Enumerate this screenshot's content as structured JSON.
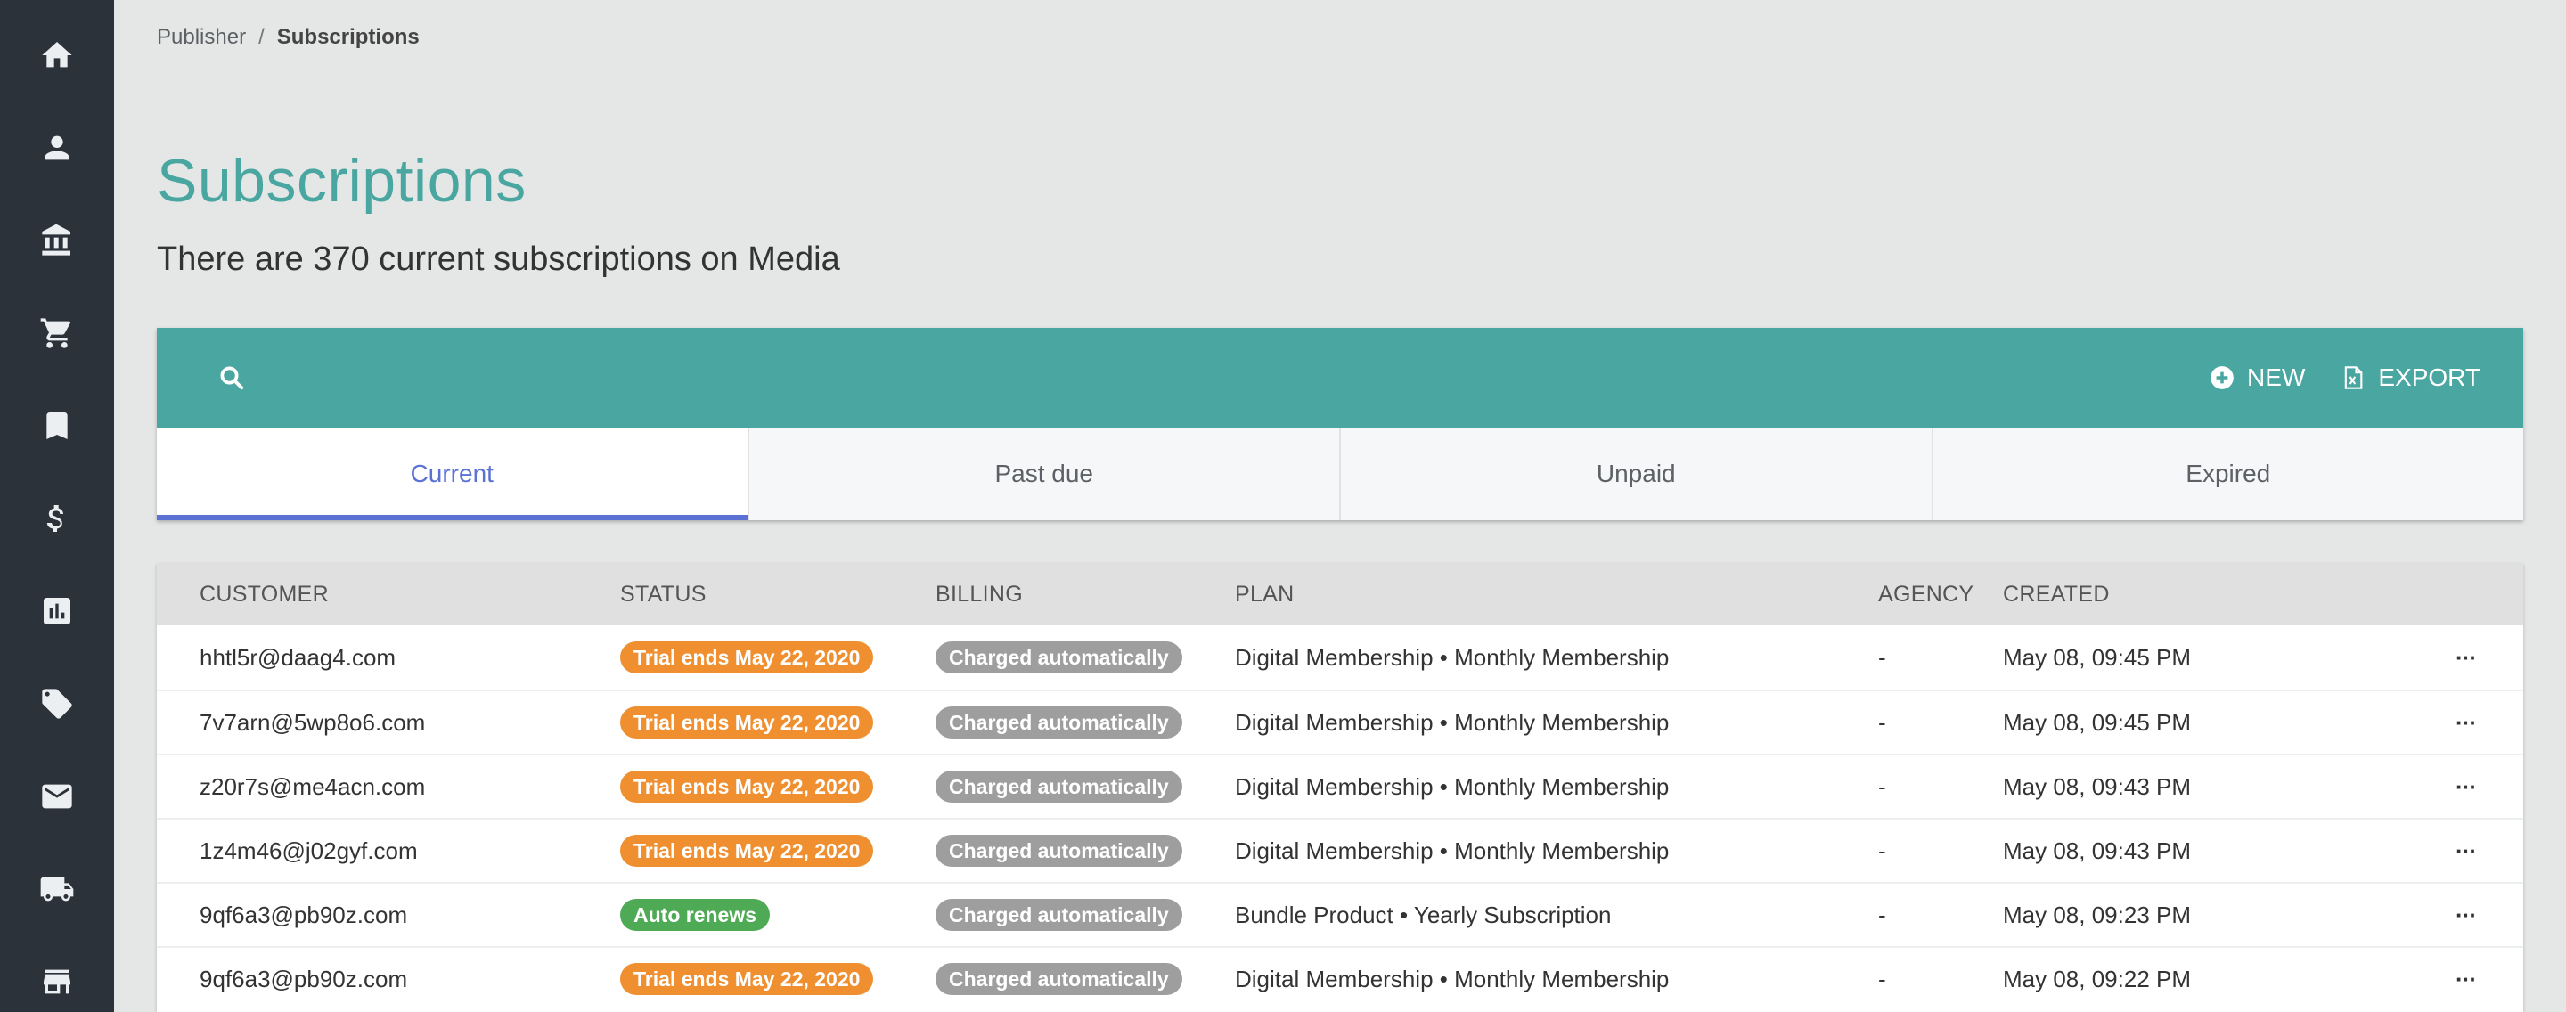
{
  "colors": {
    "sidebar_bg": "#2b323a",
    "accent": "#4aa6a0",
    "tab_active": "#5b72d4",
    "trial_badge": "#ef8f2f",
    "auto_badge": "#4faa55",
    "billing_badge": "#9e9e9e"
  },
  "sidebar": {
    "items": [
      {
        "icon": "home-icon"
      },
      {
        "icon": "person-icon"
      },
      {
        "icon": "bank-icon"
      },
      {
        "icon": "cart-icon"
      },
      {
        "icon": "bookmark-icon"
      },
      {
        "icon": "dollar-icon"
      },
      {
        "icon": "chart-icon"
      },
      {
        "icon": "ticket-icon"
      },
      {
        "icon": "mail-icon"
      },
      {
        "icon": "truck-icon"
      },
      {
        "icon": "store-icon"
      }
    ]
  },
  "breadcrumb": {
    "parent": "Publisher",
    "separator": "/",
    "current": "Subscriptions"
  },
  "page": {
    "title": "Subscriptions",
    "subtitle": "There are 370 current subscriptions on Media"
  },
  "toolbar": {
    "search_icon": "search-icon",
    "new_label": "NEW",
    "export_label": "EXPORT"
  },
  "tabs": [
    {
      "label": "Current",
      "active": true
    },
    {
      "label": "Past due",
      "active": false
    },
    {
      "label": "Unpaid",
      "active": false
    },
    {
      "label": "Expired",
      "active": false
    }
  ],
  "table": {
    "headers": {
      "customer": "CUSTOMER",
      "status": "STATUS",
      "billing": "BILLING",
      "plan": "PLAN",
      "agency": "AGENCY",
      "created": "CREATED"
    },
    "rows": [
      {
        "customer": "hhtl5r@daag4.com",
        "status": "Trial ends May 22, 2020",
        "status_type": "trial",
        "billing": "Charged automatically",
        "plan": "Digital Membership • Monthly Membership",
        "agency": "-",
        "created": "May 08, 09:45 PM",
        "more": "···"
      },
      {
        "customer": "7v7arn@5wp8o6.com",
        "status": "Trial ends May 22, 2020",
        "status_type": "trial",
        "billing": "Charged automatically",
        "plan": "Digital Membership • Monthly Membership",
        "agency": "-",
        "created": "May 08, 09:45 PM",
        "more": "···"
      },
      {
        "customer": "z20r7s@me4acn.com",
        "status": "Trial ends May 22, 2020",
        "status_type": "trial",
        "billing": "Charged automatically",
        "plan": "Digital Membership • Monthly Membership",
        "agency": "-",
        "created": "May 08, 09:43 PM",
        "more": "···"
      },
      {
        "customer": "1z4m46@j02gyf.com",
        "status": "Trial ends May 22, 2020",
        "status_type": "trial",
        "billing": "Charged automatically",
        "plan": "Digital Membership • Monthly Membership",
        "agency": "-",
        "created": "May 08, 09:43 PM",
        "more": "···"
      },
      {
        "customer": "9qf6a3@pb90z.com",
        "status": "Auto renews",
        "status_type": "auto",
        "billing": "Charged automatically",
        "plan": "Bundle Product • Yearly Subscription",
        "agency": "-",
        "created": "May 08, 09:23 PM",
        "more": "···"
      },
      {
        "customer": "9qf6a3@pb90z.com",
        "status": "Trial ends May 22, 2020",
        "status_type": "trial",
        "billing": "Charged automatically",
        "plan": "Digital Membership • Monthly Membership",
        "agency": "-",
        "created": "May 08, 09:22 PM",
        "more": "···"
      }
    ]
  }
}
